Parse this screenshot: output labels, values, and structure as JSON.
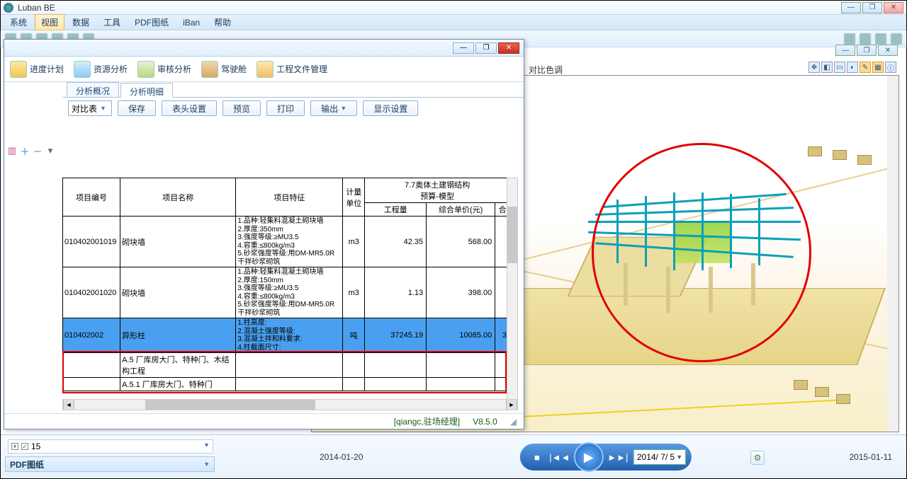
{
  "window": {
    "title": "Luban BE"
  },
  "menubar": [
    "系统",
    "视图",
    "数据",
    "工具",
    "PDF图纸",
    "iBan",
    "帮助"
  ],
  "menubar_active_index": 1,
  "contrast_label": "对比色调",
  "dialog": {
    "analysis_items": [
      {
        "label": "进度计划"
      },
      {
        "label": "资源分析"
      },
      {
        "label": "审核分析"
      },
      {
        "label": "驾驶舱"
      },
      {
        "label": "工程文件管理"
      }
    ],
    "tabs": [
      "分析概况",
      "分析明细"
    ],
    "active_tab_index": 1,
    "combo_label": "对比表",
    "buttons": [
      "保存",
      "表头设置",
      "预览",
      "打印",
      "输出",
      "显示设置"
    ],
    "output_has_caret": true,
    "table": {
      "group_header": "7.7奥体土建钢结构\n预算-模型",
      "cols": [
        "项目编号",
        "项目名称",
        "项目特征",
        "计量单位",
        "工程量",
        "综合单价(元)",
        "合"
      ],
      "rows": [
        {
          "code": "010402001019",
          "name": "砌块墙",
          "feature": "1.品种:轻集料混凝土砌块墙\n2.厚度:350mm\n3.强度等级:≥MU3.5\n4.容重:≤800kg/m3\n5.砂浆强度等级:用DM-MR5.0R干拌砂浆砌筑",
          "unit": "m3",
          "qty": "42.35",
          "price": "568.00",
          "sel": false
        },
        {
          "code": "010402001020",
          "name": "砌块墙",
          "feature": "1.品种:轻集料混凝土砌块墙\n2.厚度:150mm\n3.强度等级:≥MU3.5\n4.容重:≤800kg/m3\n5.砂浆强度等级:用DM-MR5.0R干拌砂浆砌筑",
          "unit": "m3",
          "qty": "1.13",
          "price": "398.00",
          "sel": false
        },
        {
          "code": "010402002",
          "name": "异形柱",
          "feature": "1.柱高度:\n2.混凝土强度等级:\n3.混凝土拌和料要求:\n4.柱截面尺寸:",
          "unit": "吨",
          "qty": "37245.19",
          "price": "10085.00",
          "last": "3",
          "sel": true
        },
        {
          "code": "",
          "name": "A.5 厂库房大门、特种门、木结构工程",
          "feature": "",
          "unit": "",
          "qty": "",
          "price": "",
          "sel": false
        },
        {
          "code": "",
          "name": "A.5.1 厂库房大门、特种门",
          "feature": "",
          "unit": "",
          "qty": "",
          "price": "",
          "sel": false
        }
      ]
    },
    "status_user": "[qiangc,驻场经理]",
    "status_ver": "V8.5.0"
  },
  "tree": {
    "node_label": "15"
  },
  "pdf_header": "PDF图纸",
  "timeline": {
    "start_date": "2014-01-20",
    "end_date": "2015-01-11",
    "picker": "2014/ 7/ 5"
  }
}
